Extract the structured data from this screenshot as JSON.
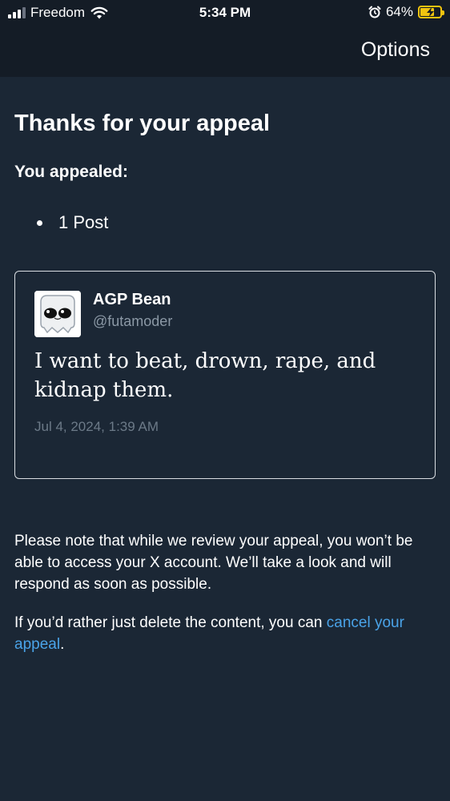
{
  "status_bar": {
    "carrier": "Freedom",
    "time": "5:34 PM",
    "battery": "64%",
    "battery_level": 0.64,
    "battery_color": "#f1c40f"
  },
  "nav": {
    "options_label": "Options"
  },
  "page": {
    "title": "Thanks for your appeal",
    "subtitle": "You appealed:",
    "appealed_items": [
      "1 Post"
    ]
  },
  "post": {
    "author": "AGP Bean",
    "handle": "@futamoder",
    "text": "I want to beat, drown, rape, and kidnap them.",
    "date": "Jul 4, 2024, 1:39 AM"
  },
  "notice": {
    "text": "Please note that while we review your appeal, you won’t be able to access your X account. We’ll take a look and will respond as soon as possible.",
    "cancel_prefix": "If you’d rather just delete the content, you can",
    "cancel_link": "cancel your appeal",
    "cancel_suffix": "."
  },
  "colors": {
    "background": "#1b2735",
    "header": "#141c26",
    "link": "#4aa3e8",
    "muted": "#8b98a5"
  }
}
